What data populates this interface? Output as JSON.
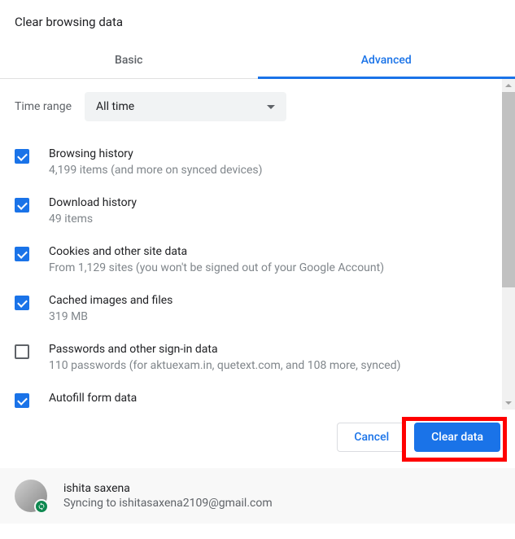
{
  "dialog": {
    "title": "Clear browsing data"
  },
  "tabs": {
    "basic": "Basic",
    "advanced": "Advanced"
  },
  "time_range": {
    "label": "Time range",
    "value": "All time"
  },
  "items": [
    {
      "title": "Browsing history",
      "desc": "4,199 items (and more on synced devices)",
      "checked": true
    },
    {
      "title": "Download history",
      "desc": "49 items",
      "checked": true
    },
    {
      "title": "Cookies and other site data",
      "desc": "From 1,129 sites (you won't be signed out of your Google Account)",
      "checked": true
    },
    {
      "title": "Cached images and files",
      "desc": "319 MB",
      "checked": true
    },
    {
      "title": "Passwords and other sign-in data",
      "desc": "110 passwords (for aktuexam.in, quetext.com, and 108 more, synced)",
      "checked": false
    },
    {
      "title": "Autofill form data",
      "desc": "",
      "checked": true
    }
  ],
  "buttons": {
    "cancel": "Cancel",
    "clear": "Clear data"
  },
  "footer": {
    "name": "ishita saxena",
    "status": "Syncing to ishitasaxena2109@gmail.com"
  }
}
